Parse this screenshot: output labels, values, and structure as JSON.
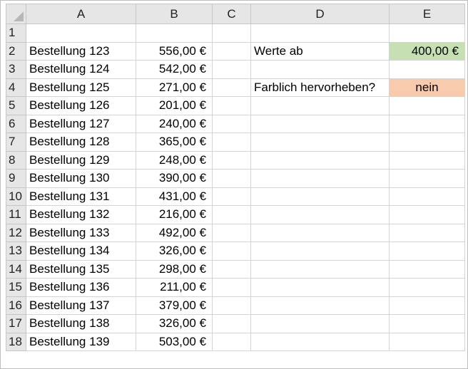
{
  "columns": [
    "A",
    "B",
    "C",
    "D",
    "E"
  ],
  "rows": [
    {
      "row": "1",
      "a": "",
      "b": "",
      "d": "",
      "e": ""
    },
    {
      "row": "2",
      "a": "Bestellung 123",
      "b": "556,00 €",
      "d": "Werte ab",
      "e": "400,00 €"
    },
    {
      "row": "3",
      "a": "Bestellung 124",
      "b": "542,00 €",
      "d": "",
      "e": ""
    },
    {
      "row": "4",
      "a": "Bestellung 125",
      "b": "271,00 €",
      "d": "Farblich hervorheben?",
      "e": "nein"
    },
    {
      "row": "5",
      "a": "Bestellung 126",
      "b": "201,00 €",
      "d": "",
      "e": ""
    },
    {
      "row": "6",
      "a": "Bestellung 127",
      "b": "240,00 €",
      "d": "",
      "e": ""
    },
    {
      "row": "7",
      "a": "Bestellung 128",
      "b": "365,00 €",
      "d": "",
      "e": ""
    },
    {
      "row": "8",
      "a": "Bestellung 129",
      "b": "248,00 €",
      "d": "",
      "e": ""
    },
    {
      "row": "9",
      "a": "Bestellung 130",
      "b": "390,00 €",
      "d": "",
      "e": ""
    },
    {
      "row": "10",
      "a": "Bestellung 131",
      "b": "431,00 €",
      "d": "",
      "e": ""
    },
    {
      "row": "11",
      "a": "Bestellung 132",
      "b": "216,00 €",
      "d": "",
      "e": ""
    },
    {
      "row": "12",
      "a": "Bestellung 133",
      "b": "492,00 €",
      "d": "",
      "e": ""
    },
    {
      "row": "13",
      "a": "Bestellung 134",
      "b": "326,00 €",
      "d": "",
      "e": ""
    },
    {
      "row": "14",
      "a": "Bestellung 135",
      "b": "298,00 €",
      "d": "",
      "e": ""
    },
    {
      "row": "15",
      "a": "Bestellung 136",
      "b": "211,00 €",
      "d": "",
      "e": ""
    },
    {
      "row": "16",
      "a": "Bestellung 137",
      "b": "379,00 €",
      "d": "",
      "e": ""
    },
    {
      "row": "17",
      "a": "Bestellung 138",
      "b": "326,00 €",
      "d": "",
      "e": ""
    },
    {
      "row": "18",
      "a": "Bestellung 139",
      "b": "503,00 €",
      "d": "",
      "e": ""
    }
  ],
  "colors": {
    "threshold_cell": "#c6e0b4",
    "highlight_cell": "#f8cbad",
    "header_bg": "#e6e6e6",
    "grid": "#d4d4d4"
  }
}
